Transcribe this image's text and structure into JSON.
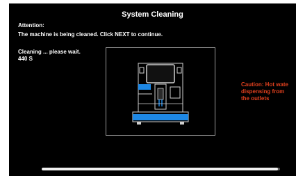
{
  "screen": {
    "title": "System Cleaning",
    "attention_label": "Attention:",
    "attention_message": "The machine is being cleaned. Click NEXT to continue.",
    "status_text": "Cleaning ... please wait. 440 S",
    "caution_text": "Caution: Hot water dispensing from the outlets",
    "caution_lines": [
      "Caution: Hot wate",
      "dispensing from",
      "the outlets"
    ],
    "progress_fraction": 0.99
  },
  "colors": {
    "background": "#000000",
    "text": "#ffffff",
    "caution": "#e0401e",
    "highlight": "#1e90ff"
  },
  "icons": {
    "machine": "coffee-machine-icon"
  }
}
